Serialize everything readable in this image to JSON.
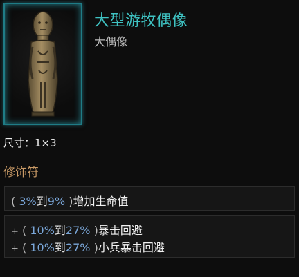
{
  "item": {
    "name": "大型游牧偶像",
    "type": "大偶像",
    "size_label": "尺寸：",
    "size_value": "1×3",
    "icon": "idol-statue-icon",
    "frame_color": "#2aa9b7",
    "title_color": "#3fc3c3"
  },
  "modifiers": {
    "heading": "修饰符",
    "implicit": [
      {
        "open": "(",
        "min": "3%",
        "to": "到",
        "max": "9%",
        "close": ")",
        "text": "增加生命值"
      }
    ],
    "explicit": [
      {
        "prefix": "+",
        "open": "(",
        "min": "10%",
        "to": "到",
        "max": "27%",
        "close": ")",
        "text": "暴击回避"
      },
      {
        "prefix": "+",
        "open": "(",
        "min": "10%",
        "to": "到",
        "max": "27%",
        "close": ")",
        "text": "小兵暴击回避"
      }
    ]
  }
}
